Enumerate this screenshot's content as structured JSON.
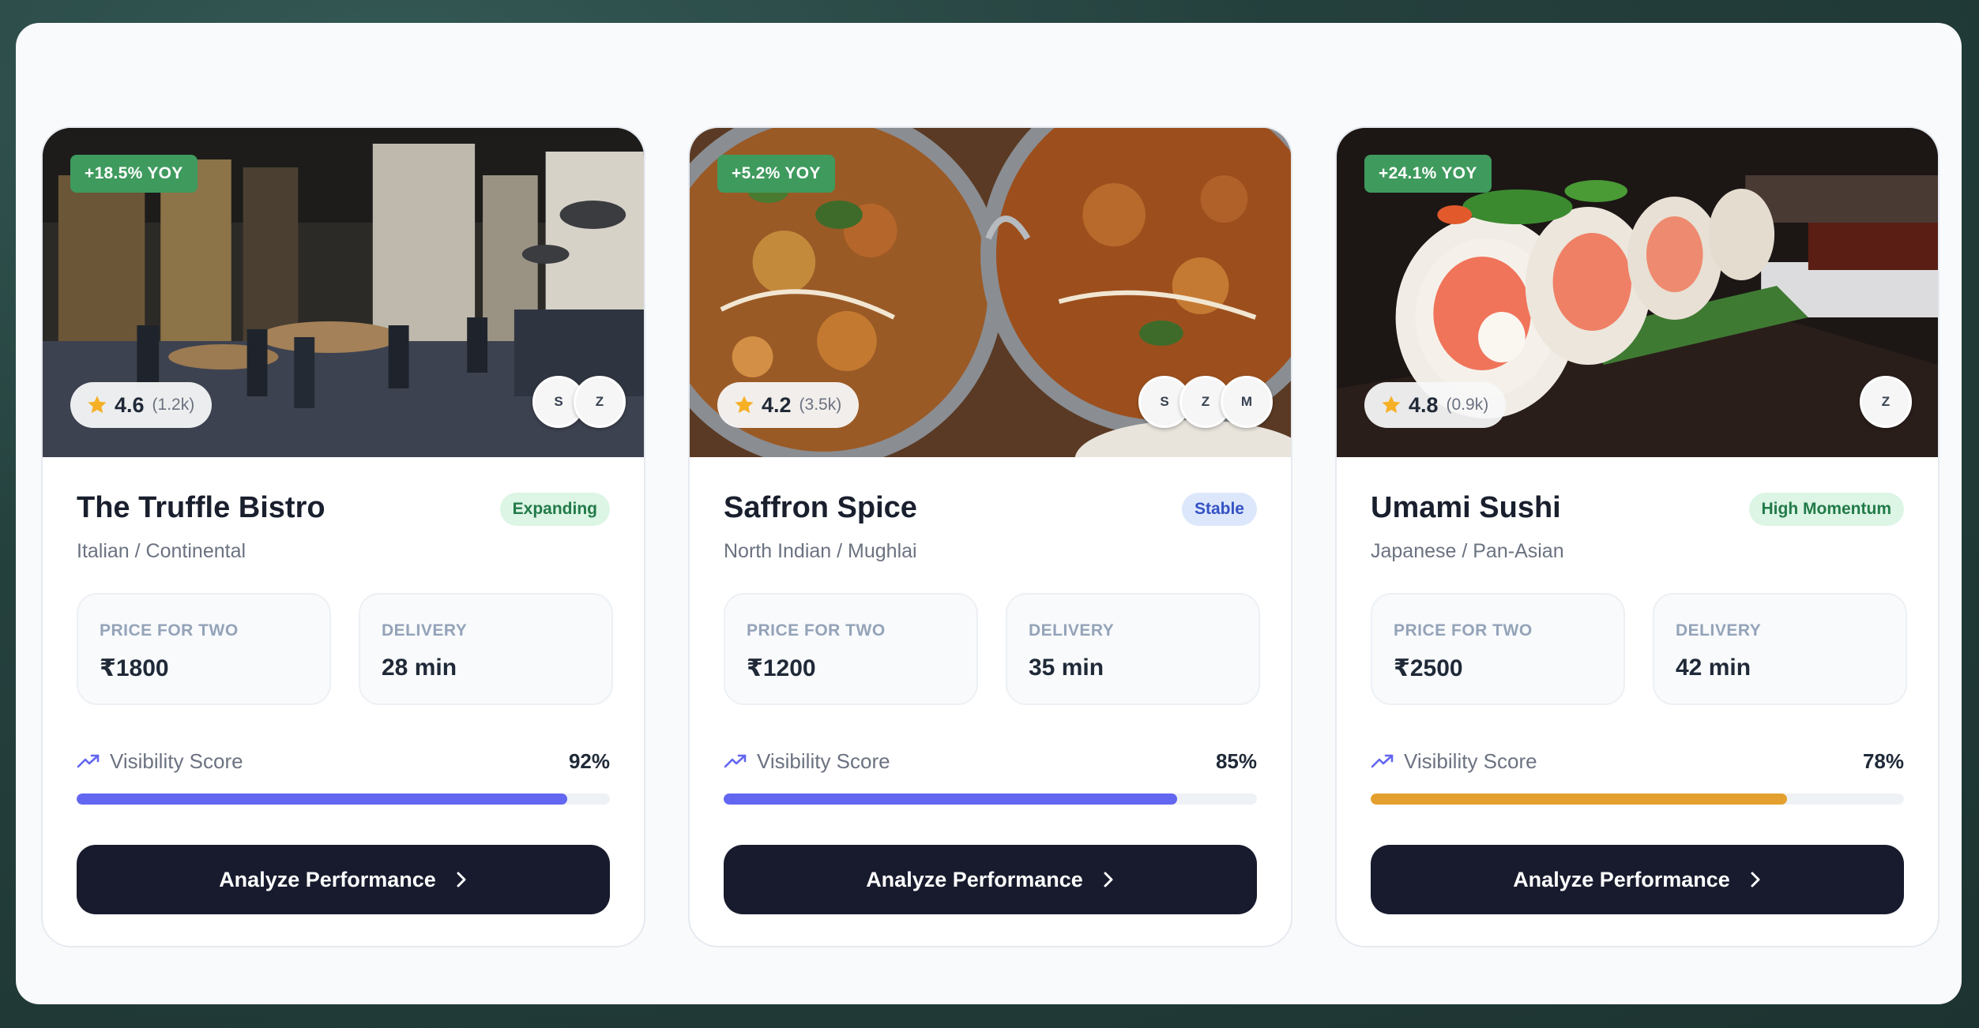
{
  "colors": {
    "accent_indigo": "#6366f1",
    "accent_amber": "#e3a02e",
    "yoy_badge": "#3f9a5e",
    "button_dark": "#171b2d",
    "status_green_text": "#227a48",
    "status_blue_text": "#3452c5"
  },
  "cards": [
    {
      "name": "The Truffle Bistro",
      "cuisine": "Italian / Continental",
      "status": "Expanding",
      "status_tone": "green",
      "yoy": "+18.5% YOY",
      "rating": "4.6",
      "rating_count": "(1.2k)",
      "platforms": [
        "S",
        "Z"
      ],
      "price_label": "PRICE FOR TWO",
      "price": "₹1800",
      "delivery_label": "DELIVERY",
      "delivery": "28 min",
      "visibility_label": "Visibility Score",
      "visibility_pct": "92%",
      "visibility_value": 0.92,
      "bar_color": "#6366f1",
      "button_label": "Analyze Performance",
      "image": "restaurant-interior"
    },
    {
      "name": "Saffron Spice",
      "cuisine": "North Indian / Mughlai",
      "status": "Stable",
      "status_tone": "blue",
      "yoy": "+5.2% YOY",
      "rating": "4.2",
      "rating_count": "(3.5k)",
      "platforms": [
        "S",
        "Z",
        "M"
      ],
      "price_label": "PRICE FOR TWO",
      "price": "₹1200",
      "delivery_label": "DELIVERY",
      "delivery": "35 min",
      "visibility_label": "Visibility Score",
      "visibility_pct": "85%",
      "visibility_value": 0.85,
      "bar_color": "#6366f1",
      "button_label": "Analyze Performance",
      "image": "curry-bowls"
    },
    {
      "name": "Umami Sushi",
      "cuisine": "Japanese / Pan-Asian",
      "status": "High Momentum",
      "status_tone": "green",
      "yoy": "+24.1% YOY",
      "rating": "4.8",
      "rating_count": "(0.9k)",
      "platforms": [
        "Z"
      ],
      "price_label": "PRICE FOR TWO",
      "price": "₹2500",
      "delivery_label": "DELIVERY",
      "delivery": "42 min",
      "visibility_label": "Visibility Score",
      "visibility_pct": "78%",
      "visibility_value": 0.78,
      "bar_color": "#e3a02e",
      "button_label": "Analyze Performance",
      "image": "sushi-rolls"
    }
  ]
}
